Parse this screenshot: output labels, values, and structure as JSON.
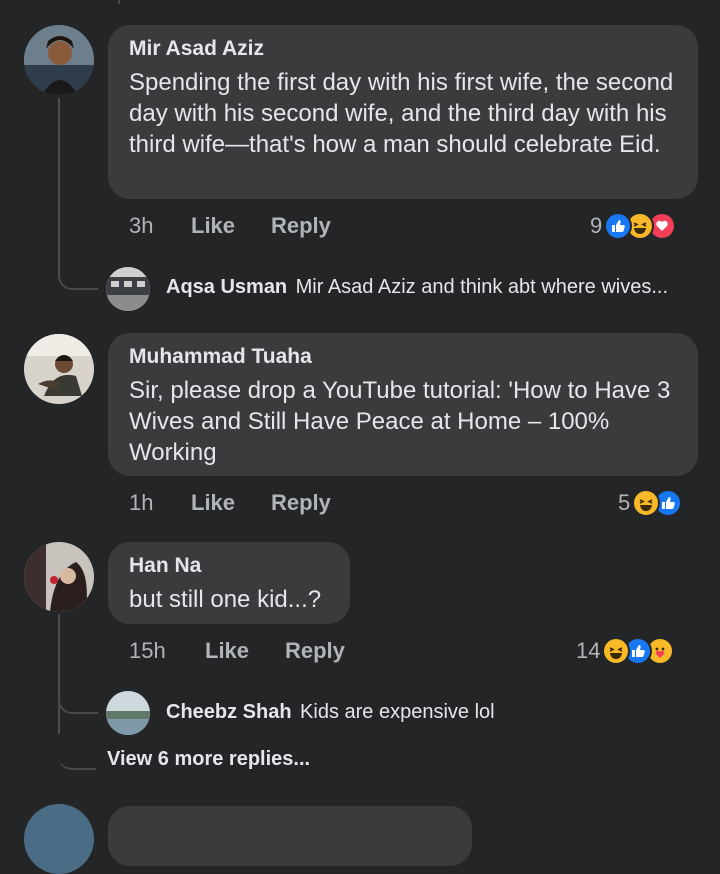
{
  "comments": [
    {
      "author": "Mir Asad Aziz",
      "text": "Spending the first day with his first wife, the second day with his second wife, and the third day with his third wife—that's how a man should celebrate Eid.",
      "time": "3h",
      "like_label": "Like",
      "reply_label": "Reply",
      "reaction_count": "9",
      "reactions": [
        "like",
        "haha",
        "love"
      ]
    },
    {
      "author": "Muhammad Tuaha",
      "text": "Sir, please drop a YouTube tutorial: 'How to Have 3 Wives and Still Have Peace at Home – 100% Working",
      "time": "1h",
      "like_label": "Like",
      "reply_label": "Reply",
      "reaction_count": "5",
      "reactions": [
        "haha",
        "like"
      ]
    },
    {
      "author": "Han Na",
      "text": "but still one kid...?",
      "time": "15h",
      "like_label": "Like",
      "reply_label": "Reply",
      "reaction_count": "14",
      "reactions": [
        "haha",
        "like",
        "care"
      ]
    }
  ],
  "replies": [
    {
      "author": "Aqsa Usman",
      "text": "Mir Asad Aziz and think abt where wives..."
    },
    {
      "author": "Cheebz Shah",
      "text": "Kids are expensive lol"
    }
  ],
  "view_more": "View 6 more replies...",
  "colors": {
    "background": "#242526",
    "bubble": "#3a3b3c",
    "like_blue": "#1877f2",
    "haha_yellow": "#f7b928",
    "love_red": "#f33e58"
  }
}
